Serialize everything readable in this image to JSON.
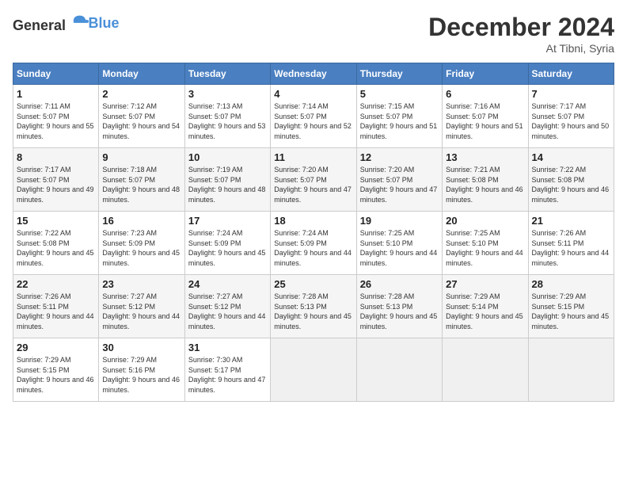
{
  "logo": {
    "general": "General",
    "blue": "Blue"
  },
  "header": {
    "month": "December 2024",
    "location": "At Tibni, Syria"
  },
  "weekdays": [
    "Sunday",
    "Monday",
    "Tuesday",
    "Wednesday",
    "Thursday",
    "Friday",
    "Saturday"
  ],
  "days": [
    {
      "num": "",
      "sunrise": "",
      "sunset": "",
      "daylight": ""
    },
    {
      "num": "",
      "sunrise": "",
      "sunset": "",
      "daylight": ""
    },
    {
      "num": "",
      "sunrise": "",
      "sunset": "",
      "daylight": ""
    },
    {
      "num": "",
      "sunrise": "",
      "sunset": "",
      "daylight": ""
    },
    {
      "num": "",
      "sunrise": "",
      "sunset": "",
      "daylight": ""
    },
    {
      "num": "",
      "sunrise": "",
      "sunset": "",
      "daylight": ""
    },
    {
      "num": "7",
      "sunrise": "Sunrise: 7:17 AM",
      "sunset": "Sunset: 5:07 PM",
      "daylight": "Daylight: 9 hours and 50 minutes."
    },
    {
      "num": "8",
      "sunrise": "Sunrise: 7:17 AM",
      "sunset": "Sunset: 5:07 PM",
      "daylight": "Daylight: 9 hours and 49 minutes."
    },
    {
      "num": "9",
      "sunrise": "Sunrise: 7:18 AM",
      "sunset": "Sunset: 5:07 PM",
      "daylight": "Daylight: 9 hours and 48 minutes."
    },
    {
      "num": "10",
      "sunrise": "Sunrise: 7:19 AM",
      "sunset": "Sunset: 5:07 PM",
      "daylight": "Daylight: 9 hours and 48 minutes."
    },
    {
      "num": "11",
      "sunrise": "Sunrise: 7:20 AM",
      "sunset": "Sunset: 5:07 PM",
      "daylight": "Daylight: 9 hours and 47 minutes."
    },
    {
      "num": "12",
      "sunrise": "Sunrise: 7:20 AM",
      "sunset": "Sunset: 5:07 PM",
      "daylight": "Daylight: 9 hours and 47 minutes."
    },
    {
      "num": "13",
      "sunrise": "Sunrise: 7:21 AM",
      "sunset": "Sunset: 5:08 PM",
      "daylight": "Daylight: 9 hours and 46 minutes."
    },
    {
      "num": "14",
      "sunrise": "Sunrise: 7:22 AM",
      "sunset": "Sunset: 5:08 PM",
      "daylight": "Daylight: 9 hours and 46 minutes."
    },
    {
      "num": "15",
      "sunrise": "Sunrise: 7:22 AM",
      "sunset": "Sunset: 5:08 PM",
      "daylight": "Daylight: 9 hours and 45 minutes."
    },
    {
      "num": "16",
      "sunrise": "Sunrise: 7:23 AM",
      "sunset": "Sunset: 5:09 PM",
      "daylight": "Daylight: 9 hours and 45 minutes."
    },
    {
      "num": "17",
      "sunrise": "Sunrise: 7:24 AM",
      "sunset": "Sunset: 5:09 PM",
      "daylight": "Daylight: 9 hours and 45 minutes."
    },
    {
      "num": "18",
      "sunrise": "Sunrise: 7:24 AM",
      "sunset": "Sunset: 5:09 PM",
      "daylight": "Daylight: 9 hours and 44 minutes."
    },
    {
      "num": "19",
      "sunrise": "Sunrise: 7:25 AM",
      "sunset": "Sunset: 5:10 PM",
      "daylight": "Daylight: 9 hours and 44 minutes."
    },
    {
      "num": "20",
      "sunrise": "Sunrise: 7:25 AM",
      "sunset": "Sunset: 5:10 PM",
      "daylight": "Daylight: 9 hours and 44 minutes."
    },
    {
      "num": "21",
      "sunrise": "Sunrise: 7:26 AM",
      "sunset": "Sunset: 5:11 PM",
      "daylight": "Daylight: 9 hours and 44 minutes."
    },
    {
      "num": "22",
      "sunrise": "Sunrise: 7:26 AM",
      "sunset": "Sunset: 5:11 PM",
      "daylight": "Daylight: 9 hours and 44 minutes."
    },
    {
      "num": "23",
      "sunrise": "Sunrise: 7:27 AM",
      "sunset": "Sunset: 5:12 PM",
      "daylight": "Daylight: 9 hours and 44 minutes."
    },
    {
      "num": "24",
      "sunrise": "Sunrise: 7:27 AM",
      "sunset": "Sunset: 5:12 PM",
      "daylight": "Daylight: 9 hours and 44 minutes."
    },
    {
      "num": "25",
      "sunrise": "Sunrise: 7:28 AM",
      "sunset": "Sunset: 5:13 PM",
      "daylight": "Daylight: 9 hours and 45 minutes."
    },
    {
      "num": "26",
      "sunrise": "Sunrise: 7:28 AM",
      "sunset": "Sunset: 5:13 PM",
      "daylight": "Daylight: 9 hours and 45 minutes."
    },
    {
      "num": "27",
      "sunrise": "Sunrise: 7:29 AM",
      "sunset": "Sunset: 5:14 PM",
      "daylight": "Daylight: 9 hours and 45 minutes."
    },
    {
      "num": "28",
      "sunrise": "Sunrise: 7:29 AM",
      "sunset": "Sunset: 5:15 PM",
      "daylight": "Daylight: 9 hours and 45 minutes."
    },
    {
      "num": "29",
      "sunrise": "Sunrise: 7:29 AM",
      "sunset": "Sunset: 5:15 PM",
      "daylight": "Daylight: 9 hours and 46 minutes."
    },
    {
      "num": "30",
      "sunrise": "Sunrise: 7:29 AM",
      "sunset": "Sunset: 5:16 PM",
      "daylight": "Daylight: 9 hours and 46 minutes."
    },
    {
      "num": "31",
      "sunrise": "Sunrise: 7:30 AM",
      "sunset": "Sunset: 5:17 PM",
      "daylight": "Daylight: 9 hours and 47 minutes."
    },
    {
      "num": "",
      "sunrise": "",
      "sunset": "",
      "daylight": ""
    },
    {
      "num": "",
      "sunrise": "",
      "sunset": "",
      "daylight": ""
    },
    {
      "num": "",
      "sunrise": "",
      "sunset": "",
      "daylight": ""
    },
    {
      "num": "",
      "sunrise": "",
      "sunset": "",
      "daylight": ""
    },
    {
      "num": "1",
      "sunrise": "Sunrise: 7:11 AM",
      "sunset": "Sunset: 5:07 PM",
      "daylight": "Daylight: 9 hours and 55 minutes."
    },
    {
      "num": "2",
      "sunrise": "Sunrise: 7:12 AM",
      "sunset": "Sunset: 5:07 PM",
      "daylight": "Daylight: 9 hours and 54 minutes."
    },
    {
      "num": "3",
      "sunrise": "Sunrise: 7:13 AM",
      "sunset": "Sunset: 5:07 PM",
      "daylight": "Daylight: 9 hours and 53 minutes."
    },
    {
      "num": "4",
      "sunrise": "Sunrise: 7:14 AM",
      "sunset": "Sunset: 5:07 PM",
      "daylight": "Daylight: 9 hours and 52 minutes."
    },
    {
      "num": "5",
      "sunrise": "Sunrise: 7:15 AM",
      "sunset": "Sunset: 5:07 PM",
      "daylight": "Daylight: 9 hours and 51 minutes."
    },
    {
      "num": "6",
      "sunrise": "Sunrise: 7:16 AM",
      "sunset": "Sunset: 5:07 PM",
      "daylight": "Daylight: 9 hours and 51 minutes."
    }
  ]
}
